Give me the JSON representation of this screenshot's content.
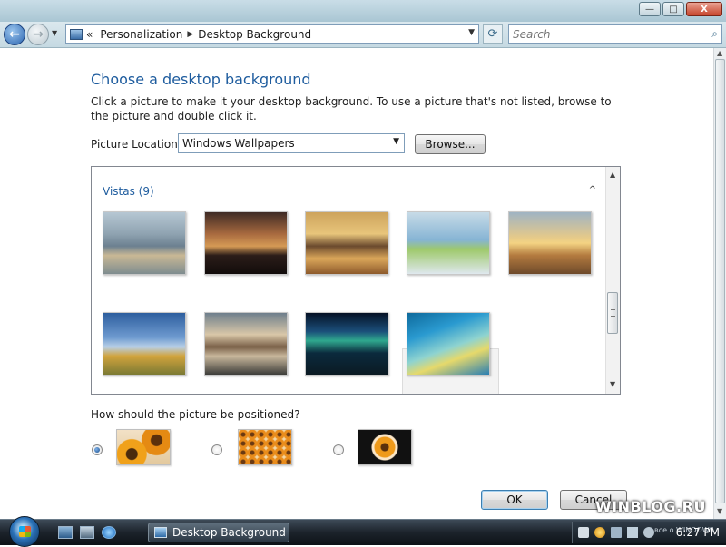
{
  "window": {
    "controls": {
      "minimize": "—",
      "maximize": "□",
      "close": "X"
    }
  },
  "nav": {
    "back_glyph": "←",
    "forward_glyph": "→",
    "history_glyph": "▼",
    "breadcrumb_overflow": "«",
    "breadcrumb": [
      "Personalization",
      "Desktop Background"
    ],
    "breadcrumb_sep": "▶",
    "address_dropdown": "▼",
    "refresh_glyph": "⟳",
    "search_placeholder": "Search",
    "search_icon": "⌕"
  },
  "page": {
    "title": "Choose a desktop background",
    "description": "Click a picture to make it your desktop background. To use a picture that's not listed, browse to the picture and double click it.",
    "location_label": "Picture Location",
    "location_value": "Windows Wallpapers",
    "location_dropdown": "▼",
    "browse_label": "Browse...",
    "group_label": "Vistas (9)",
    "group_toggle": "^",
    "position_question": "How should the picture be positioned?",
    "position_options": [
      {
        "name": "fit to screen",
        "selected": true
      },
      {
        "name": "tile",
        "selected": false
      },
      {
        "name": "center",
        "selected": false
      }
    ],
    "ok_label": "OK",
    "cancel_label": "Cancel",
    "watermark": "WINBLOG.RU"
  },
  "wallpapers": [
    "river-mountains",
    "sunset-rocks",
    "golden-rocks-water",
    "palm-leaf",
    "sunrise-grass",
    "hill-sky",
    "canyon-lake",
    "aurora",
    "vista-waves"
  ],
  "scroll": {
    "up": "▲",
    "down": "▼",
    "grip": "≡"
  },
  "taskbar": {
    "task_label": "Desktop Background",
    "tray_overlay": "все о WINDOWS",
    "clock": "6:27 PM"
  },
  "colors": {
    "accent_heading": "#1e5c9e",
    "taskbar": "#1c232b",
    "titlebar": "#a9c6d3"
  }
}
